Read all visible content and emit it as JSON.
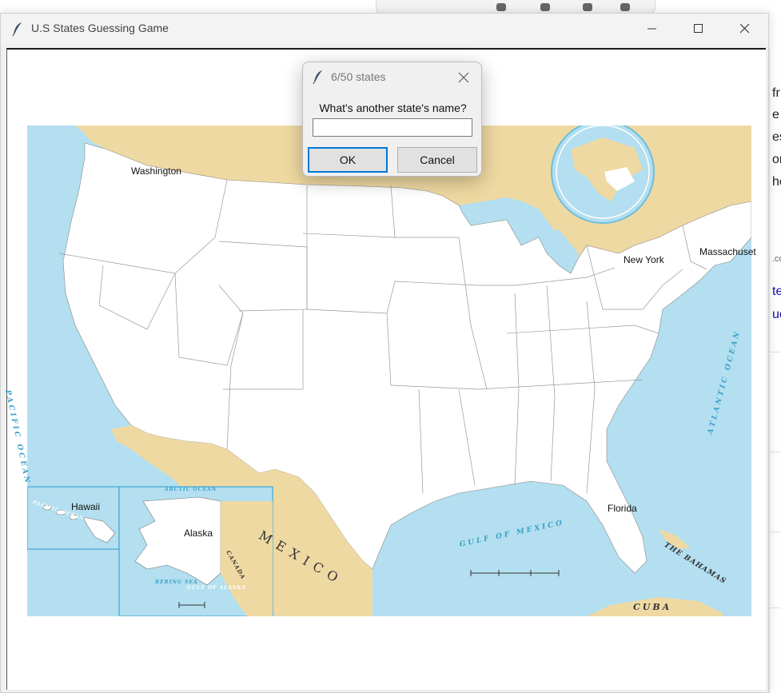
{
  "window": {
    "title": "U.S States Guessing Game"
  },
  "dialog": {
    "title": "6/50 states",
    "prompt": "What's another state's name?",
    "input_value": "",
    "ok_label": "OK",
    "cancel_label": "Cancel"
  },
  "map": {
    "guessed_states": [
      {
        "name": "Washington"
      },
      {
        "name": "New York"
      },
      {
        "name": "Massachuset"
      },
      {
        "name": "Florida"
      },
      {
        "name": "Hawaii"
      },
      {
        "name": "Alaska"
      }
    ],
    "labels": {
      "pacific": "PACIFIC OCEAN",
      "atlantic": "ATLANTIC OCEAN",
      "gulf": "GULF OF MEXICO",
      "mexico": "MEXICO",
      "bahamas": "THE BAHAMAS",
      "cuba": "CUBA",
      "canada": "CANADA",
      "arctic": "ARCTIC OCEAN",
      "bering": "BERING SEA",
      "alaska_gulf": "GULF OF ALASKA",
      "pacific_small": "PACIFIC OCEAN"
    }
  },
  "background": {
    "right_fragments": [
      "fr",
      "e",
      "es",
      "on",
      "he",
      ".co",
      "te",
      "uc"
    ]
  },
  "colors": {
    "land_us": "#ffffff",
    "land_foreign": "#efd9a2",
    "water": "#b3dff0",
    "dialog_bg": "#f0f0f0",
    "ok_focus": "#0078d7"
  }
}
